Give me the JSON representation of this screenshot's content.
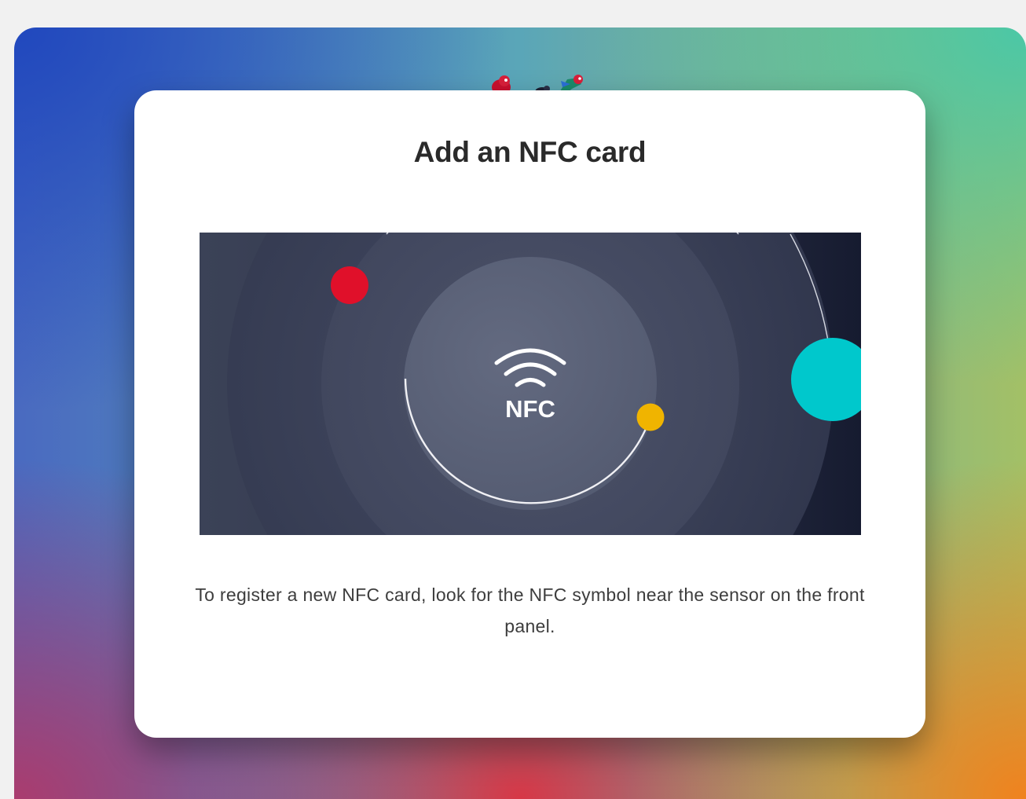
{
  "dialog": {
    "title": "Add an NFC card",
    "description": "To register a new NFC card, look for the NFC symbol near the sensor on the front panel."
  },
  "illustration": {
    "label": "NFC",
    "icon": "nfc-waves-icon"
  },
  "colors": {
    "accent_red": "#e0102a",
    "accent_cyan": "#00c8cc",
    "accent_yellow": "#f0b400",
    "title_text": "#2a2a2a",
    "body_text": "#3d3d3d"
  }
}
